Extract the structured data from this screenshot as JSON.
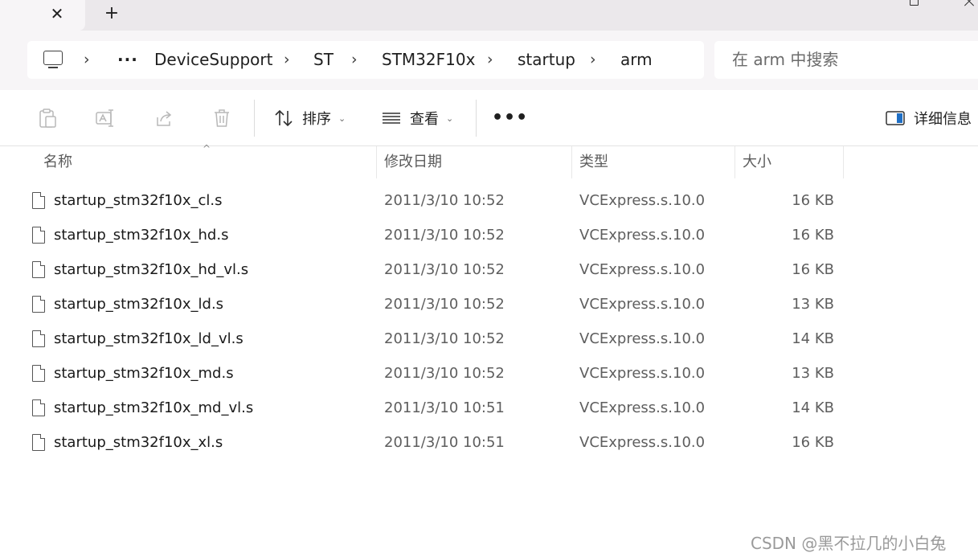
{
  "window": {
    "tab_close": "✕",
    "new_tab": "+"
  },
  "address": {
    "more": "···",
    "crumbs": [
      "DeviceSupport",
      "ST",
      "STM32F10x",
      "startup",
      "arm"
    ],
    "chevron": "›"
  },
  "search": {
    "placeholder": "在 arm 中搜索"
  },
  "toolbar": {
    "sort_label": "排序",
    "view_label": "查看",
    "more_label": "•••",
    "details_label": "详细信息",
    "dropdown_caret": "⌄"
  },
  "columns": {
    "name": "名称",
    "date": "修改日期",
    "type": "类型",
    "size": "大小",
    "sort_indicator": "^"
  },
  "files": [
    {
      "name": "startup_stm32f10x_cl.s",
      "date": "2011/3/10 10:52",
      "type": "VCExpress.s.10.0",
      "size": "16 KB"
    },
    {
      "name": "startup_stm32f10x_hd.s",
      "date": "2011/3/10 10:52",
      "type": "VCExpress.s.10.0",
      "size": "16 KB"
    },
    {
      "name": "startup_stm32f10x_hd_vl.s",
      "date": "2011/3/10 10:52",
      "type": "VCExpress.s.10.0",
      "size": "16 KB"
    },
    {
      "name": "startup_stm32f10x_ld.s",
      "date": "2011/3/10 10:52",
      "type": "VCExpress.s.10.0",
      "size": "13 KB"
    },
    {
      "name": "startup_stm32f10x_ld_vl.s",
      "date": "2011/3/10 10:52",
      "type": "VCExpress.s.10.0",
      "size": "14 KB"
    },
    {
      "name": "startup_stm32f10x_md.s",
      "date": "2011/3/10 10:52",
      "type": "VCExpress.s.10.0",
      "size": "13 KB"
    },
    {
      "name": "startup_stm32f10x_md_vl.s",
      "date": "2011/3/10 10:51",
      "type": "VCExpress.s.10.0",
      "size": "14 KB"
    },
    {
      "name": "startup_stm32f10x_xl.s",
      "date": "2011/3/10 10:51",
      "type": "VCExpress.s.10.0",
      "size": "16 KB"
    }
  ],
  "watermark": "CSDN @黑不拉几的小白兔",
  "colors": {
    "titlebar": "#ebe8eb",
    "address_row": "#f7f5f7",
    "details_icon_accent": "#1f6fc5"
  }
}
